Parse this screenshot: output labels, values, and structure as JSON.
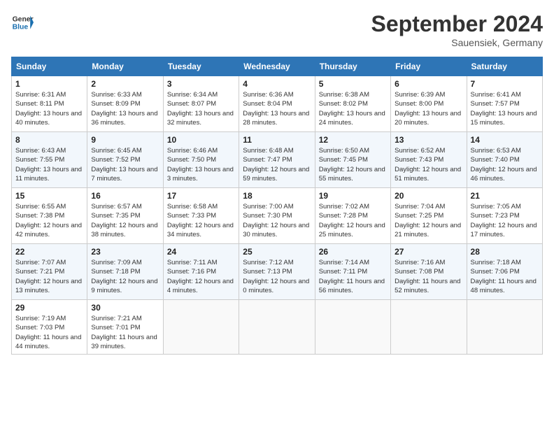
{
  "header": {
    "logo_line1": "General",
    "logo_line2": "Blue",
    "month": "September 2024",
    "location": "Sauensiek, Germany"
  },
  "weekdays": [
    "Sunday",
    "Monday",
    "Tuesday",
    "Wednesday",
    "Thursday",
    "Friday",
    "Saturday"
  ],
  "weeks": [
    [
      {
        "day": "1",
        "sunrise": "6:31 AM",
        "sunset": "8:11 PM",
        "daylight": "13 hours and 40 minutes."
      },
      {
        "day": "2",
        "sunrise": "6:33 AM",
        "sunset": "8:09 PM",
        "daylight": "13 hours and 36 minutes."
      },
      {
        "day": "3",
        "sunrise": "6:34 AM",
        "sunset": "8:07 PM",
        "daylight": "13 hours and 32 minutes."
      },
      {
        "day": "4",
        "sunrise": "6:36 AM",
        "sunset": "8:04 PM",
        "daylight": "13 hours and 28 minutes."
      },
      {
        "day": "5",
        "sunrise": "6:38 AM",
        "sunset": "8:02 PM",
        "daylight": "13 hours and 24 minutes."
      },
      {
        "day": "6",
        "sunrise": "6:39 AM",
        "sunset": "8:00 PM",
        "daylight": "13 hours and 20 minutes."
      },
      {
        "day": "7",
        "sunrise": "6:41 AM",
        "sunset": "7:57 PM",
        "daylight": "13 hours and 15 minutes."
      }
    ],
    [
      {
        "day": "8",
        "sunrise": "6:43 AM",
        "sunset": "7:55 PM",
        "daylight": "13 hours and 11 minutes."
      },
      {
        "day": "9",
        "sunrise": "6:45 AM",
        "sunset": "7:52 PM",
        "daylight": "13 hours and 7 minutes."
      },
      {
        "day": "10",
        "sunrise": "6:46 AM",
        "sunset": "7:50 PM",
        "daylight": "13 hours and 3 minutes."
      },
      {
        "day": "11",
        "sunrise": "6:48 AM",
        "sunset": "7:47 PM",
        "daylight": "12 hours and 59 minutes."
      },
      {
        "day": "12",
        "sunrise": "6:50 AM",
        "sunset": "7:45 PM",
        "daylight": "12 hours and 55 minutes."
      },
      {
        "day": "13",
        "sunrise": "6:52 AM",
        "sunset": "7:43 PM",
        "daylight": "12 hours and 51 minutes."
      },
      {
        "day": "14",
        "sunrise": "6:53 AM",
        "sunset": "7:40 PM",
        "daylight": "12 hours and 46 minutes."
      }
    ],
    [
      {
        "day": "15",
        "sunrise": "6:55 AM",
        "sunset": "7:38 PM",
        "daylight": "12 hours and 42 minutes."
      },
      {
        "day": "16",
        "sunrise": "6:57 AM",
        "sunset": "7:35 PM",
        "daylight": "12 hours and 38 minutes."
      },
      {
        "day": "17",
        "sunrise": "6:58 AM",
        "sunset": "7:33 PM",
        "daylight": "12 hours and 34 minutes."
      },
      {
        "day": "18",
        "sunrise": "7:00 AM",
        "sunset": "7:30 PM",
        "daylight": "12 hours and 30 minutes."
      },
      {
        "day": "19",
        "sunrise": "7:02 AM",
        "sunset": "7:28 PM",
        "daylight": "12 hours and 25 minutes."
      },
      {
        "day": "20",
        "sunrise": "7:04 AM",
        "sunset": "7:25 PM",
        "daylight": "12 hours and 21 minutes."
      },
      {
        "day": "21",
        "sunrise": "7:05 AM",
        "sunset": "7:23 PM",
        "daylight": "12 hours and 17 minutes."
      }
    ],
    [
      {
        "day": "22",
        "sunrise": "7:07 AM",
        "sunset": "7:21 PM",
        "daylight": "12 hours and 13 minutes."
      },
      {
        "day": "23",
        "sunrise": "7:09 AM",
        "sunset": "7:18 PM",
        "daylight": "12 hours and 9 minutes."
      },
      {
        "day": "24",
        "sunrise": "7:11 AM",
        "sunset": "7:16 PM",
        "daylight": "12 hours and 4 minutes."
      },
      {
        "day": "25",
        "sunrise": "7:12 AM",
        "sunset": "7:13 PM",
        "daylight": "12 hours and 0 minutes."
      },
      {
        "day": "26",
        "sunrise": "7:14 AM",
        "sunset": "7:11 PM",
        "daylight": "11 hours and 56 minutes."
      },
      {
        "day": "27",
        "sunrise": "7:16 AM",
        "sunset": "7:08 PM",
        "daylight": "11 hours and 52 minutes."
      },
      {
        "day": "28",
        "sunrise": "7:18 AM",
        "sunset": "7:06 PM",
        "daylight": "11 hours and 48 minutes."
      }
    ],
    [
      {
        "day": "29",
        "sunrise": "7:19 AM",
        "sunset": "7:03 PM",
        "daylight": "11 hours and 44 minutes."
      },
      {
        "day": "30",
        "sunrise": "7:21 AM",
        "sunset": "7:01 PM",
        "daylight": "11 hours and 39 minutes."
      },
      null,
      null,
      null,
      null,
      null
    ]
  ]
}
